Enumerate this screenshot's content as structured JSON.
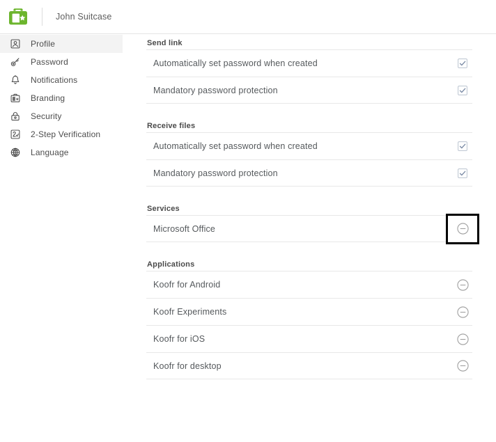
{
  "header": {
    "logo_icon": "koofr-suitcase-logo",
    "account_name": "John Suitcase"
  },
  "sidebar": {
    "items": [
      {
        "label": "Profile",
        "icon": "user-badge-icon",
        "active": true
      },
      {
        "label": "Password",
        "icon": "key-icon",
        "active": false
      },
      {
        "label": "Notifications",
        "icon": "bell-icon",
        "active": false
      },
      {
        "label": "Branding",
        "icon": "suitcase-star-icon",
        "active": false
      },
      {
        "label": "Security",
        "icon": "lock-icon",
        "active": false
      },
      {
        "label": "2-Step Verification",
        "icon": "two-step-icon",
        "active": false
      },
      {
        "label": "Language",
        "icon": "globe-icon",
        "active": false
      }
    ]
  },
  "main": {
    "sections": [
      {
        "title": "Send link",
        "control_type": "checkbox",
        "rows": [
          {
            "label": "Automatically set password when created",
            "checked": true
          },
          {
            "label": "Mandatory password protection",
            "checked": true
          }
        ]
      },
      {
        "title": "Receive files",
        "control_type": "checkbox",
        "rows": [
          {
            "label": "Automatically set password when created",
            "checked": true
          },
          {
            "label": "Mandatory password protection",
            "checked": true
          }
        ]
      },
      {
        "title": "Services",
        "control_type": "remove",
        "rows": [
          {
            "label": "Microsoft Office",
            "focused": true
          }
        ]
      },
      {
        "title": "Applications",
        "control_type": "remove",
        "rows": [
          {
            "label": "Koofr for Android",
            "focused": false
          },
          {
            "label": "Koofr Experiments",
            "focused": false
          },
          {
            "label": "Koofr for iOS",
            "focused": false
          },
          {
            "label": "Koofr for desktop",
            "focused": false
          }
        ]
      }
    ]
  },
  "colors": {
    "brand_green": "#6cb52d",
    "checkbox_check": "#7b8ba6",
    "checkbox_border": "#b9c2cf",
    "minus_stroke": "#9a9a9a",
    "divider": "#e8e8e8",
    "focus_outline": "#000000",
    "active_nav_bg": "#f3f3f3"
  }
}
